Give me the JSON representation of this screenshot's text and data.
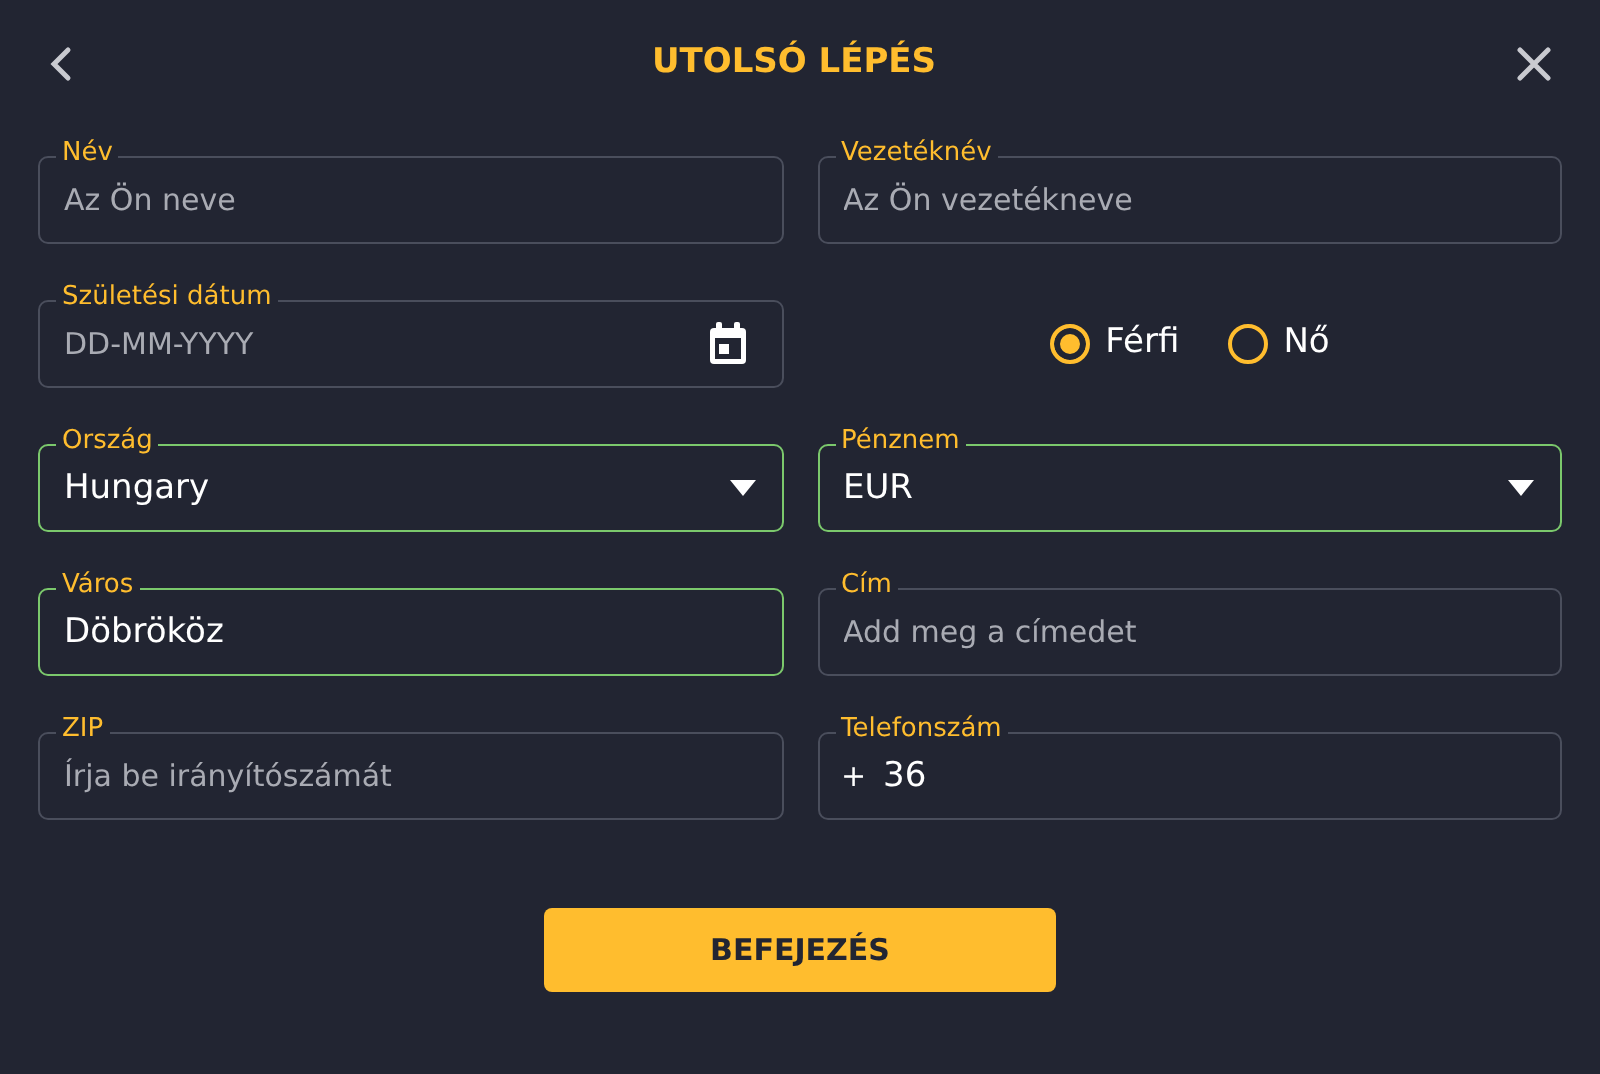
{
  "header": {
    "title": "UTOLSÓ LÉPÉS"
  },
  "fields": [
    {
      "kind": "text",
      "label": "Név",
      "placeholder": "Az Ön neve",
      "valid": false
    },
    {
      "kind": "text",
      "label": "Vezetéknév",
      "placeholder": "Az Ön vezetékneve",
      "valid": false
    },
    {
      "kind": "date",
      "label": "Születési dátum",
      "placeholder": "DD-MM-YYYY",
      "valid": false
    },
    {
      "kind": "radio",
      "options": [
        {
          "label": "Férfi",
          "selected": true
        },
        {
          "label": "Nő",
          "selected": false
        }
      ]
    },
    {
      "kind": "select",
      "label": "Ország",
      "value": "Hungary",
      "valid": true
    },
    {
      "kind": "select",
      "label": "Pénznem",
      "value": "EUR",
      "valid": true
    },
    {
      "kind": "text",
      "label": "Város",
      "value": "Döbrököz",
      "valid": true
    },
    {
      "kind": "text",
      "label": "Cím",
      "placeholder": "Add meg a címedet",
      "valid": false
    },
    {
      "kind": "text",
      "label": "ZIP",
      "placeholder": "Írja be irányítószámát",
      "valid": false
    },
    {
      "kind": "phone",
      "label": "Telefonszám",
      "prefix": "+",
      "value": "36",
      "valid": false
    }
  ],
  "submit": {
    "label": "BEFEJEZÉS"
  }
}
